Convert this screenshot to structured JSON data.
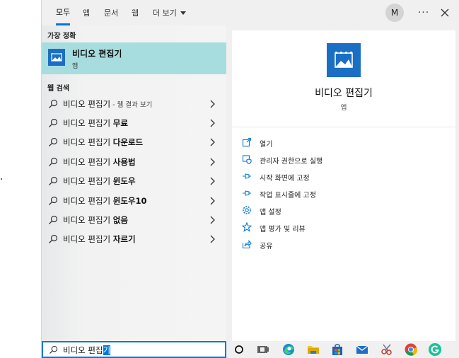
{
  "tabs": [
    {
      "label": "모두",
      "active": true
    },
    {
      "label": "앱"
    },
    {
      "label": "문서"
    },
    {
      "label": "웹"
    },
    {
      "label": "더 보기"
    }
  ],
  "header": {
    "avatar_initial": "M",
    "more_label": "···"
  },
  "best_match": {
    "section_label": "가장 정확",
    "title": "비디오 편집기",
    "subtitle": "앱"
  },
  "web": {
    "section_label": "웹 검색",
    "items": [
      {
        "prefix": "비디오 편집기",
        "bold": "",
        "suffix": " - 웹 결과 보기"
      },
      {
        "prefix": "비디오 편집기 ",
        "bold": "무료",
        "suffix": ""
      },
      {
        "prefix": "비디오 편집기 ",
        "bold": "다운로드",
        "suffix": ""
      },
      {
        "prefix": "비디오 편집기 ",
        "bold": "사용법",
        "suffix": ""
      },
      {
        "prefix": "비디오 편집기 ",
        "bold": "윈도우",
        "suffix": ""
      },
      {
        "prefix": "비디오 편집기 ",
        "bold": "윈도우10",
        "suffix": ""
      },
      {
        "prefix": "비디오 편집기 ",
        "bold": "없음",
        "suffix": ""
      },
      {
        "prefix": "비디오 편집기 ",
        "bold": "자르기",
        "suffix": ""
      }
    ]
  },
  "preview": {
    "title": "비디오 편집기",
    "type": "앱",
    "actions": [
      {
        "label": "열기",
        "icon": "open-icon"
      },
      {
        "label": "관리자 권한으로 실행",
        "icon": "shield-icon"
      },
      {
        "label": "시작 화면에 고정",
        "icon": "pin-icon"
      },
      {
        "label": "작업 표시줄에 고정",
        "icon": "pin-icon"
      },
      {
        "label": "앱 설정",
        "icon": "gear-icon"
      },
      {
        "label": "앱 평가 및 리뷰",
        "icon": "star-icon"
      },
      {
        "label": "공유",
        "icon": "share-icon"
      }
    ]
  },
  "search": {
    "typed": "비디오 편집",
    "selected": "기"
  },
  "colors": {
    "accent": "#0078d7",
    "highlight": "#a8dde0",
    "app_icon": "#1a6fc4"
  }
}
